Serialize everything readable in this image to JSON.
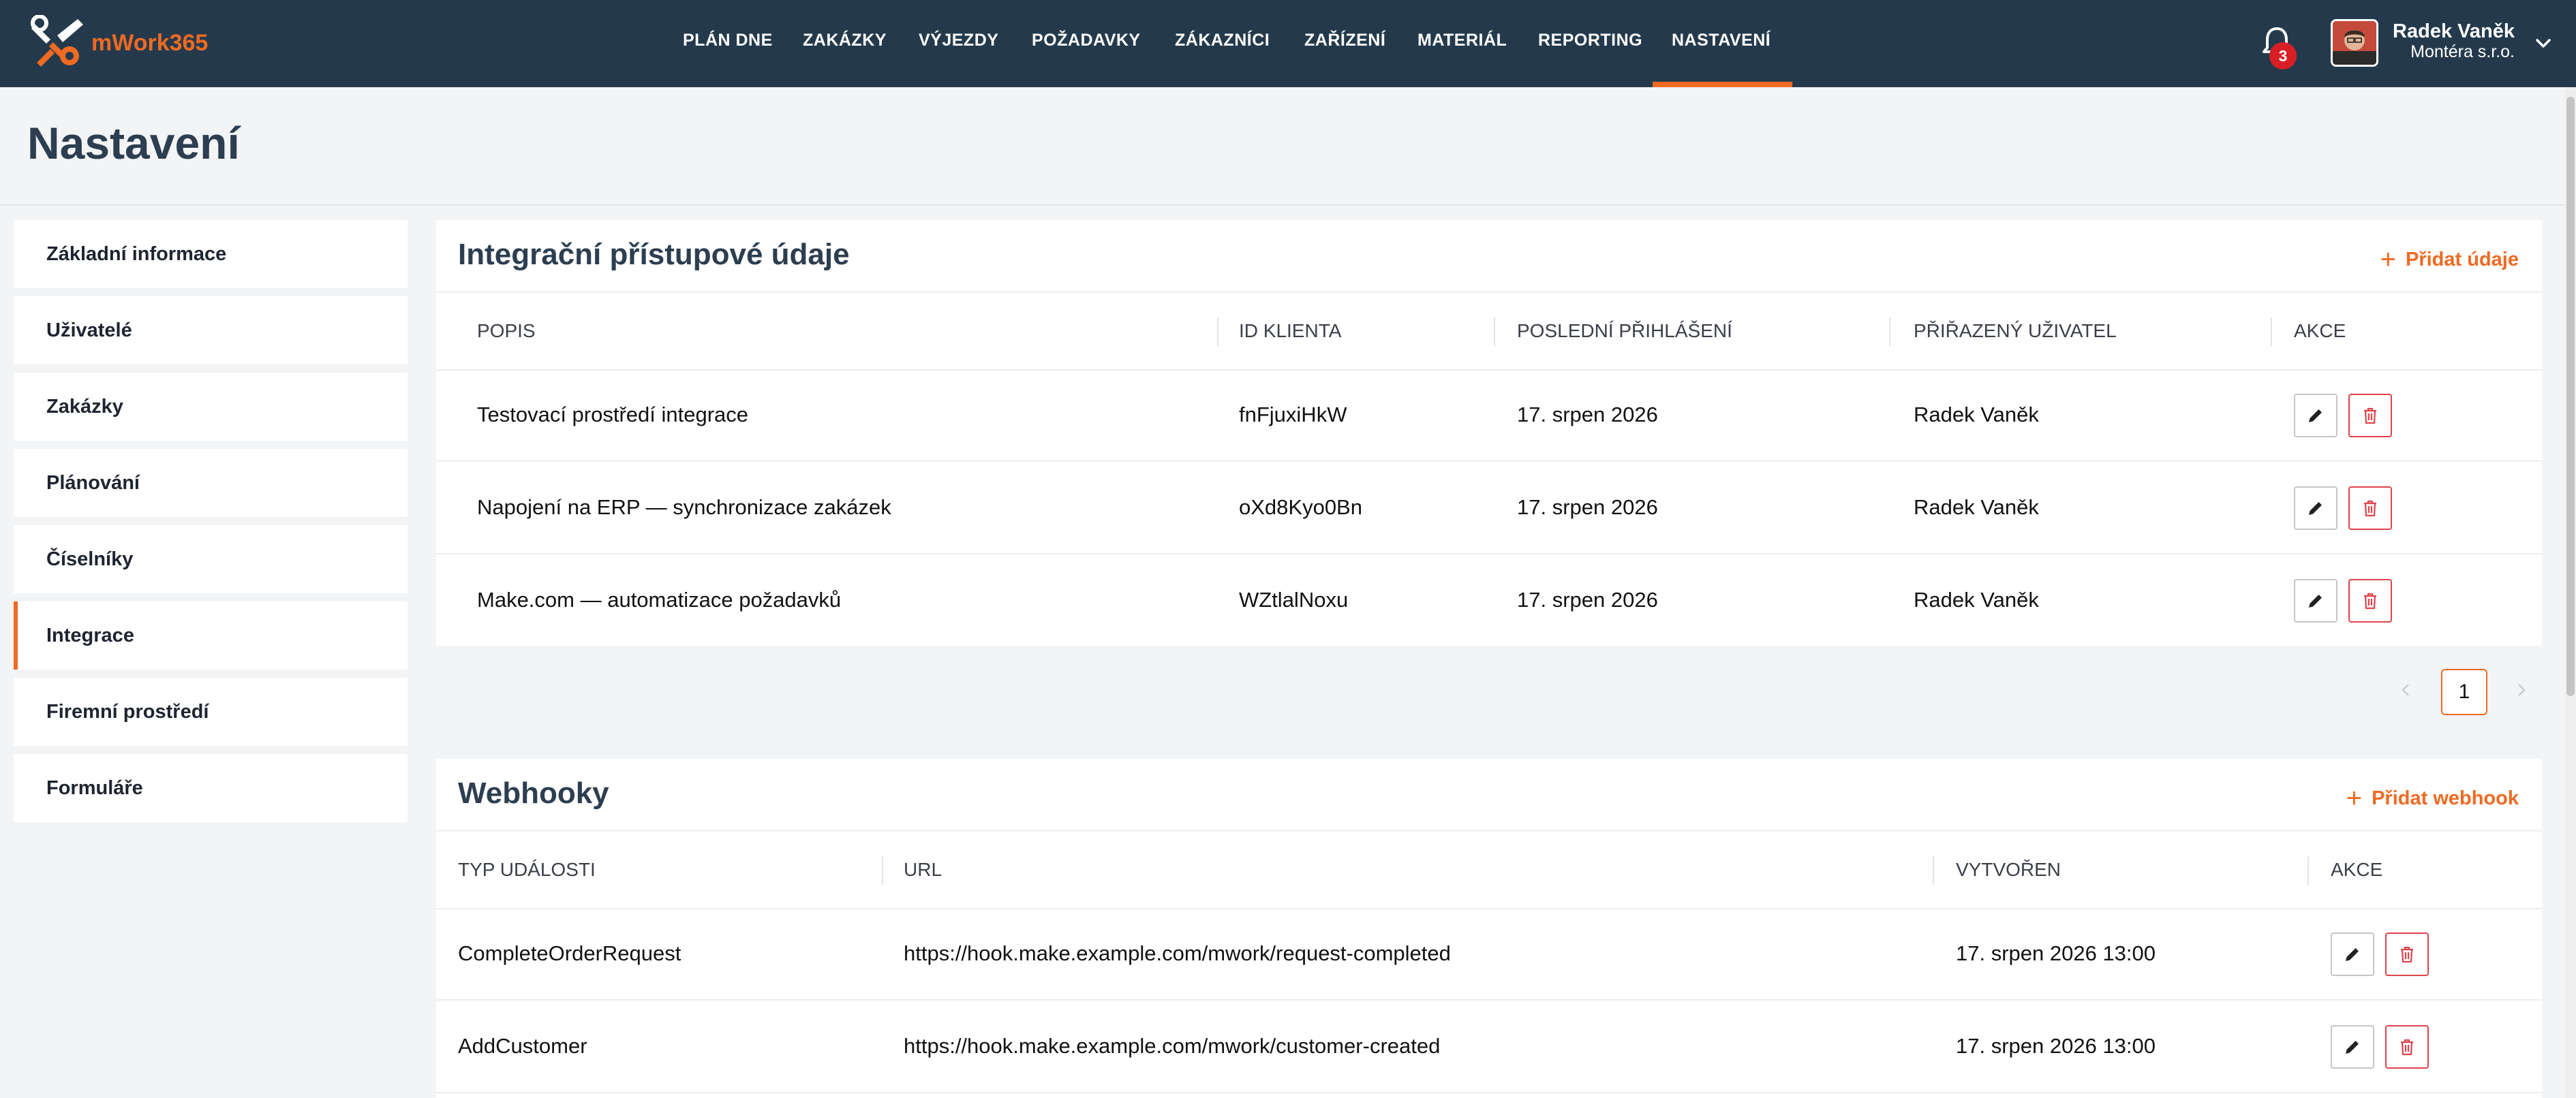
{
  "brand": {
    "logo_text": "mWork365",
    "accent": "#ef6a22",
    "nav_bg": "#243a4c"
  },
  "nav": {
    "items": [
      "PLÁN DNE",
      "ZAKÁZKY",
      "VÝJEZDY",
      "POŽADAVKY",
      "ZÁKAZNÍCI",
      "ZAŘÍZENÍ",
      "MATERIÁL",
      "REPORTING",
      "NASTAVENÍ"
    ],
    "active": "NASTAVENÍ"
  },
  "notifications": {
    "icon": "bell-icon",
    "count": "3"
  },
  "user": {
    "name": "Radek Vaněk",
    "company": "Montéra s.r.o."
  },
  "page": {
    "title": "Nastavení"
  },
  "sidebar": {
    "items": [
      {
        "label": "Základní informace"
      },
      {
        "label": "Uživatelé"
      },
      {
        "label": "Zakázky"
      },
      {
        "label": "Plánování"
      },
      {
        "label": "Číselníky"
      },
      {
        "label": "Integrace",
        "active": true
      },
      {
        "label": "Firemní prostředí"
      },
      {
        "label": "Formuláře"
      }
    ]
  },
  "integrations": {
    "title": "Integrační přístupové údaje",
    "add_label": "Přidat údaje",
    "columns": [
      "POPIS",
      "ID KLIENTA",
      "POSLEDNÍ PŘIHLÁŠENÍ",
      "PŘIŘAZENÝ UŽIVATEL",
      "AKCE"
    ],
    "rows": [
      {
        "description": "Testovací prostředí integrace",
        "client_id": "fnFjuxiHkW",
        "last_login": "17. srpen 2026",
        "user": "Radek Vaněk"
      },
      {
        "description": "Napojení na ERP — synchronizace zakázek",
        "client_id": "oXd8Kyo0Bn",
        "last_login": "17. srpen 2026",
        "user": "Radek Vaněk"
      },
      {
        "description": "Make.com — automatizace požadavků",
        "client_id": "WZtlalNoxu",
        "last_login": "17. srpen 2026",
        "user": "Radek Vaněk"
      }
    ],
    "pagination": {
      "current_page": "1"
    }
  },
  "webhooks": {
    "title": "Webhooky",
    "add_label": "Přidat webhook",
    "columns": [
      "TYP UDÁLOSTI",
      "URL",
      "VYTVOŘEN",
      "AKCE"
    ],
    "rows": [
      {
        "event": "CompleteOrderRequest",
        "url": "https://hook.make.example.com/mwork/request-completed",
        "created": "17. srpen 2026 13:00"
      },
      {
        "event": "AddCustomer",
        "url": "https://hook.make.example.com/mwork/customer-created",
        "created": "17. srpen 2026 13:00"
      }
    ]
  }
}
